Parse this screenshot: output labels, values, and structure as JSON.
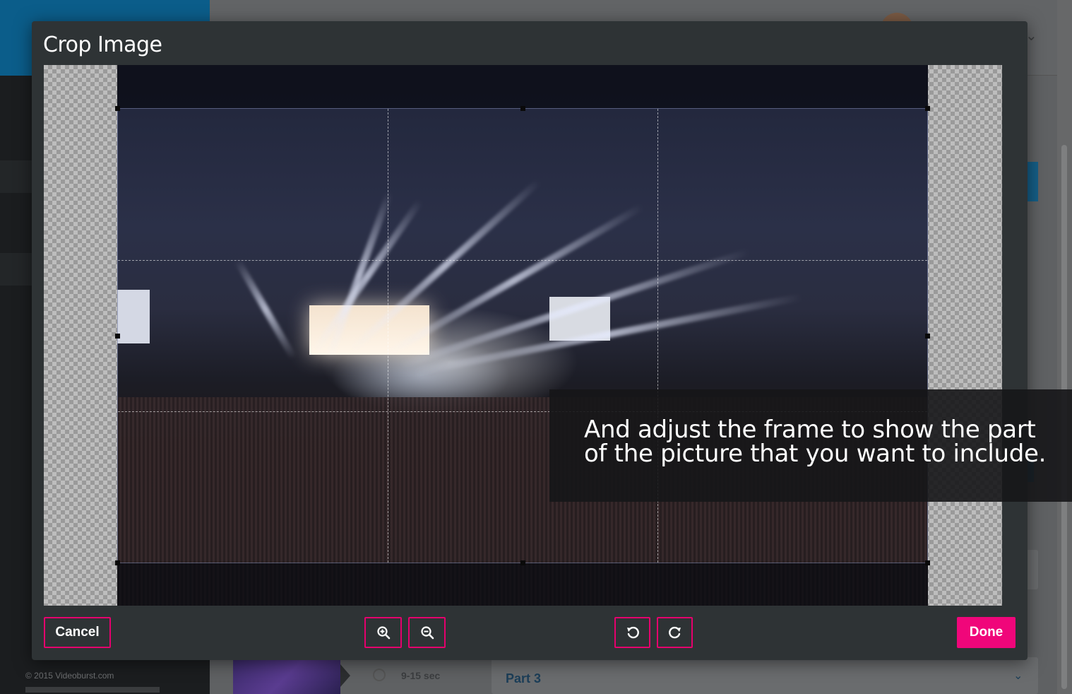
{
  "background": {
    "footer_copyright": "© 2015 Videoburst.com",
    "timeline": {
      "duration": "9-15 sec",
      "part_label": "Part 3"
    }
  },
  "modal": {
    "title": "Crop Image",
    "buttons": {
      "cancel": "Cancel",
      "done": "Done",
      "zoom_in_icon": "zoom-in-icon",
      "zoom_out_icon": "zoom-out-icon",
      "rotate_left_icon": "rotate-left-icon",
      "rotate_right_icon": "rotate-right-icon"
    }
  },
  "instruction": {
    "text": "And adjust the frame to show the part of the picture that you want to include."
  },
  "colors": {
    "accent": "#f0067a",
    "modal_bg": "#2e3335",
    "brand_blue": "#0b5d8a"
  }
}
